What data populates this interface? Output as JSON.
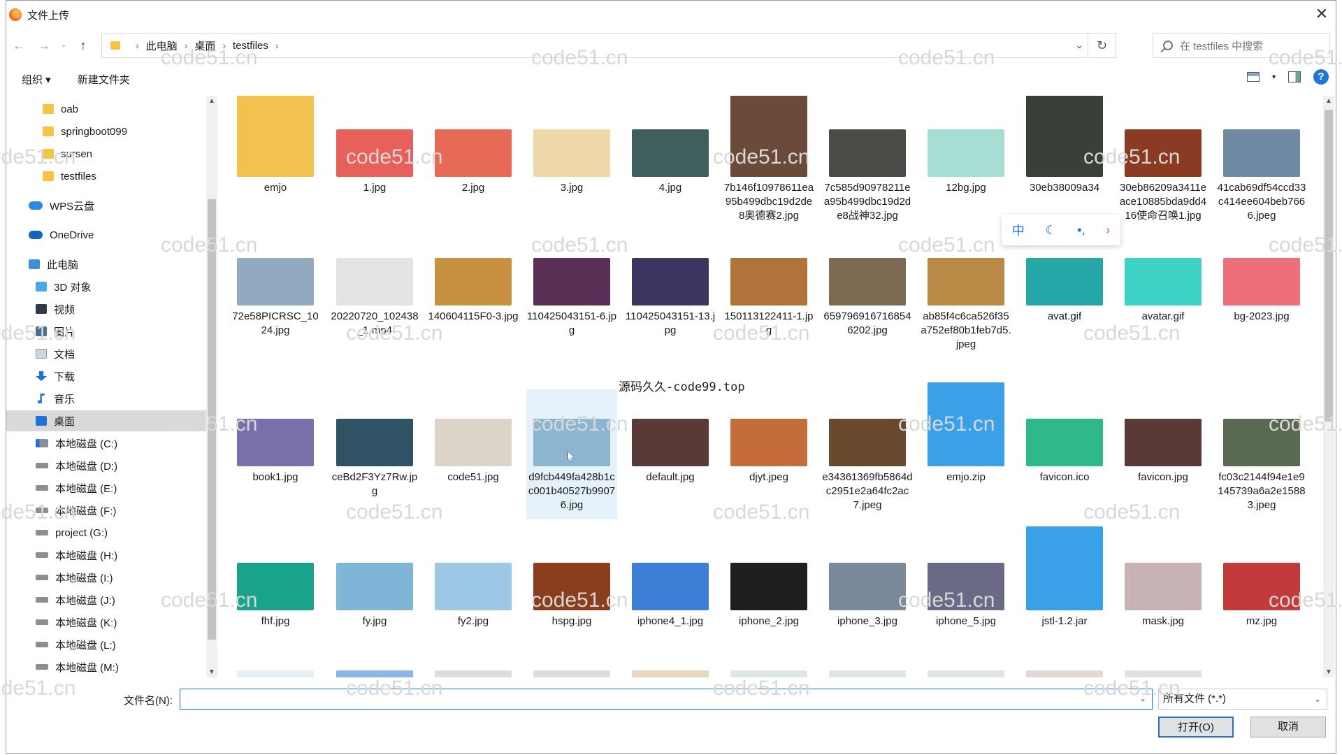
{
  "window": {
    "title": "文件上传"
  },
  "address": {
    "crumbs": [
      "此电脑",
      "桌面",
      "testfiles"
    ],
    "search_placeholder": "在 testfiles 中搜索"
  },
  "toolbar": {
    "organize": "组织 ▾",
    "new_folder": "新建文件夹"
  },
  "sidebar": {
    "items": [
      {
        "label": "oab",
        "icon": "folder-icon"
      },
      {
        "label": "springboot099",
        "icon": "folder-icon"
      },
      {
        "label": "sursen",
        "icon": "folder-icon"
      },
      {
        "label": "testfiles",
        "icon": "folder-icon"
      },
      {
        "label": "WPS云盘",
        "icon": "cloud-icon"
      },
      {
        "label": "OneDrive",
        "icon": "onedrive-icon"
      },
      {
        "label": "此电脑",
        "icon": "pc-icon"
      },
      {
        "label": "3D 对象",
        "icon": "cube-icon"
      },
      {
        "label": "视频",
        "icon": "video-icon"
      },
      {
        "label": "图片",
        "icon": "picture-icon"
      },
      {
        "label": "文档",
        "icon": "document-icon"
      },
      {
        "label": "下载",
        "icon": "download-icon"
      },
      {
        "label": "音乐",
        "icon": "music-icon"
      },
      {
        "label": "桌面",
        "icon": "desktop-icon"
      },
      {
        "label": "本地磁盘 (C:)",
        "icon": "disk-icon"
      },
      {
        "label": "本地磁盘 (D:)",
        "icon": "disk-icon"
      },
      {
        "label": "本地磁盘 (E:)",
        "icon": "disk-icon"
      },
      {
        "label": "本地磁盘 (F:)",
        "icon": "disk-icon"
      },
      {
        "label": "project (G:)",
        "icon": "disk-icon"
      },
      {
        "label": "本地磁盘 (H:)",
        "icon": "disk-icon"
      },
      {
        "label": "本地磁盘 (I:)",
        "icon": "disk-icon"
      },
      {
        "label": "本地磁盘 (J:)",
        "icon": "disk-icon"
      },
      {
        "label": "本地磁盘 (K:)",
        "icon": "disk-icon"
      },
      {
        "label": "本地磁盘 (L:)",
        "icon": "disk-icon"
      },
      {
        "label": "本地磁盘 (M:)",
        "icon": "disk-icon"
      }
    ]
  },
  "files": [
    {
      "name": "emjo",
      "color": "#f2c14e"
    },
    {
      "name": "1.jpg",
      "color": "#e8605a"
    },
    {
      "name": "2.jpg",
      "color": "#e66a55"
    },
    {
      "name": "3.jpg",
      "color": "#f0d9a8"
    },
    {
      "name": "4.jpg",
      "color": "#3f5f5c"
    },
    {
      "name": "7b146f10978611ea95b499dbc19d2de8奥德赛2.jpg",
      "color": "#6b4a3a"
    },
    {
      "name": "7c585d90978211ea95b499dbc19d2de8战神32.jpg",
      "color": "#4a4a46"
    },
    {
      "name": "12bg.jpg",
      "color": "#a7ded4"
    },
    {
      "name": "30eb38009a34",
      "color": "#3b3f3a"
    },
    {
      "name": "30eb86209a3411eace10885bda9dd416使命召唤1.jpg",
      "color": "#8a3b22"
    },
    {
      "name": "41cab69df54ccd33c414ee604beb7666.jpeg",
      "color": "#6f8aa2"
    },
    {
      "name": "72e58PICRSC_1024.jpg",
      "color": "#93a9bf"
    },
    {
      "name": "20220720_102438_1.mp4",
      "color": "#e3e3e3"
    },
    {
      "name": "140604115F0-3.jpg",
      "color": "#c7913f"
    },
    {
      "name": "110425043151-6.jpg",
      "color": "#5a2f55"
    },
    {
      "name": "110425043151-13.jpg",
      "color": "#3d3460"
    },
    {
      "name": "150113122411-1.jpg",
      "color": "#b0743a"
    },
    {
      "name": "6597969167168546202.jpg",
      "color": "#7c6a52"
    },
    {
      "name": "ab85f4c6ca526f35a752ef80b1feb7d5.jpeg",
      "color": "#b88a46"
    },
    {
      "name": "avat.gif",
      "color": "#25a7a7"
    },
    {
      "name": "avatar.gif",
      "color": "#3fd3c7"
    },
    {
      "name": "bg-2023.jpg",
      "color": "#ee6f7a"
    },
    {
      "name": "book1.jpg",
      "color": "#7a6fa8"
    },
    {
      "name": "ceBd2F3Yz7Rw.jpg",
      "color": "#2f5364"
    },
    {
      "name": "code51.jpg",
      "color": "#dcd4c8"
    },
    {
      "name": "d9fcb449fa428b1cc001b40527b99076.jpg",
      "color": "#8cb6cf"
    },
    {
      "name": "default.jpg",
      "color": "#5a3a36"
    },
    {
      "name": "djyt.jpeg",
      "color": "#c46c3a"
    },
    {
      "name": "e34361369fb5864dc2951e2a64fc2ac7.jpeg",
      "color": "#6a4a2e"
    },
    {
      "name": "emjo.zip",
      "color": "#3aa0e8"
    },
    {
      "name": "favicon.ico",
      "color": "#2fb98a"
    },
    {
      "name": "favicon.jpg",
      "color": "#5a3a36"
    },
    {
      "name": "fc03c2144f94e1e9145739a6a2e15883.jpeg",
      "color": "#5a6a52"
    },
    {
      "name": "fhf.jpg",
      "color": "#19a38a"
    },
    {
      "name": "fy.jpg",
      "color": "#7fb6d8"
    },
    {
      "name": "fy2.jpg",
      "color": "#9cc8e6"
    },
    {
      "name": "hspg.jpg",
      "color": "#8a3e1e"
    },
    {
      "name": "iphone4_1.jpg",
      "color": "#3d7fd6"
    },
    {
      "name": "iphone_2.jpg",
      "color": "#1f1f1f"
    },
    {
      "name": "iphone_3.jpg",
      "color": "#7a8a9a"
    },
    {
      "name": "iphone_5.jpg",
      "color": "#6a6a86"
    },
    {
      "name": "jstl-1.2.jar",
      "color": "#3aa0e8"
    },
    {
      "name": "mask.jpg",
      "color": "#c7b2b6"
    },
    {
      "name": "mz.jpg",
      "color": "#c23a3a"
    },
    {
      "name": "",
      "color": "#e6eef6"
    },
    {
      "name": "",
      "color": "#8ab6e8"
    },
    {
      "name": "",
      "color": "#dddddd"
    },
    {
      "name": "",
      "color": "#dddddd"
    },
    {
      "name": "",
      "color": "#e8d8c0"
    },
    {
      "name": "",
      "color": "#e0e6e8"
    },
    {
      "name": "",
      "color": "#e0e6e8"
    },
    {
      "name": "",
      "color": "#e0e6e8"
    },
    {
      "name": "",
      "color": "#e6d6d6"
    },
    {
      "name": "",
      "color": "#e0e0e0"
    },
    {
      "name": "",
      "color": "#ffffff"
    }
  ],
  "watermark": "code51.cn",
  "overlay_text": "源码久久-code99.top",
  "ime_toolbar": {
    "lang": "中"
  },
  "bottom": {
    "filename_label": "文件名(N):",
    "filename_value": "",
    "filetype": "所有文件 (*.*)",
    "open_button": "打开(O)",
    "cancel_button": "取消"
  }
}
